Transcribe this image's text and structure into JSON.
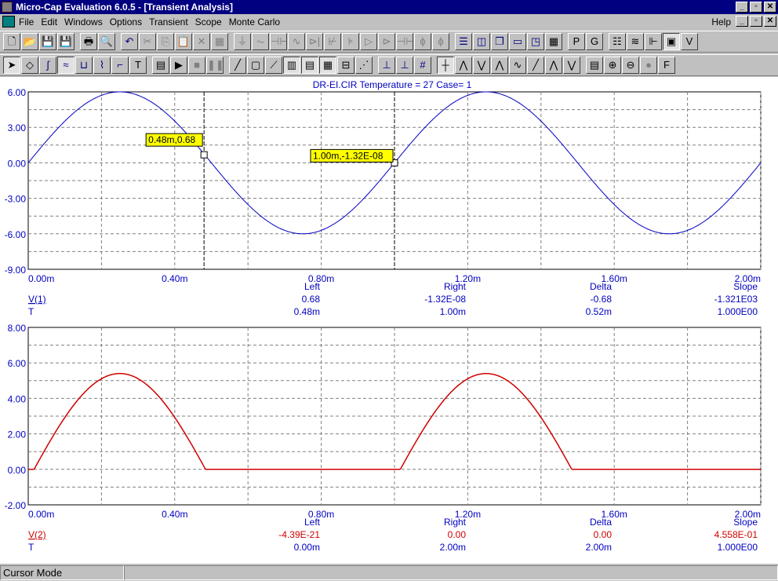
{
  "window": {
    "title": "Micro-Cap Evaluation 6.0.5 - [Transient Analysis]",
    "controls": [
      "_",
      "▫",
      "✕"
    ]
  },
  "menu": {
    "items": [
      "File",
      "Edit",
      "Windows",
      "Options",
      "Transient",
      "Scope",
      "Monte Carlo"
    ],
    "help": "Help"
  },
  "toolbar1": [
    [
      "new-icon",
      "🗋"
    ],
    [
      "open-icon",
      "📂",
      1
    ],
    [
      "save-icon",
      "💾",
      1
    ],
    [
      "save-as-icon",
      "💾",
      1
    ],
    "|",
    [
      "print-icon",
      "🖶"
    ],
    [
      "print-preview-icon",
      "🔍"
    ],
    "|",
    [
      "undo-icon",
      "↶",
      0,
      1
    ],
    [
      "cut-icon",
      "✂",
      1
    ],
    [
      "copy-icon",
      "⎘",
      1
    ],
    [
      "paste-icon",
      "📋",
      1
    ],
    [
      "delete-icon",
      "✕",
      1
    ],
    [
      "select-all-icon",
      "▦",
      1
    ],
    "|",
    [
      "ground-icon",
      "⏚",
      1
    ],
    [
      "resistor-icon",
      "⏦",
      1
    ],
    [
      "capacitor-icon",
      "⊣⊢",
      1
    ],
    [
      "inductor-icon",
      "∿",
      1
    ],
    [
      "diode-icon",
      "⊳|",
      1
    ],
    [
      "transistor-icon",
      "⊬",
      1
    ],
    [
      "mosfet-icon",
      "⊧",
      1
    ],
    [
      "opamp-icon",
      "▷",
      1
    ],
    [
      "buffer-icon",
      "⊳",
      1
    ],
    [
      "battery-icon",
      "⊣⊢",
      1
    ],
    [
      "source-icon",
      "ϕ",
      1
    ],
    [
      "current-source-icon",
      "ϕ",
      1
    ],
    "|",
    [
      "tile-horizontal-icon",
      "☰",
      0,
      1
    ],
    [
      "tile-vertical-icon",
      "◫",
      0,
      1
    ],
    [
      "cascade-icon",
      "❐",
      0,
      1
    ],
    [
      "window-icon",
      "▭",
      0,
      1
    ],
    [
      "window-split-icon",
      "◳",
      0,
      1
    ],
    [
      "calculator-icon",
      "▦"
    ],
    "|",
    [
      "p-icon",
      "P"
    ],
    [
      "g-icon",
      "G"
    ],
    "|",
    [
      "components-icon",
      "☷"
    ],
    [
      "waveform-icon",
      "≋"
    ],
    [
      "probe-icon",
      "⊩"
    ],
    [
      "scope-icon",
      "▣",
      0,
      0,
      1
    ],
    [
      "vi-icon",
      "V"
    ]
  ],
  "toolbar2": [
    [
      "select-arrow-icon",
      "➤",
      0,
      0,
      1
    ],
    [
      "component-mode-icon",
      "◇"
    ],
    [
      "wire-mode-icon",
      "∫",
      0,
      1
    ],
    [
      "graph-mode-icon",
      "≈",
      0,
      1,
      1
    ],
    [
      "label-icon",
      "⊔",
      0,
      1
    ],
    [
      "info-icon",
      "⌇",
      0,
      1
    ],
    [
      "diagonal-wire-icon",
      "⌐",
      0,
      1
    ],
    [
      "text-icon",
      "T"
    ],
    "|",
    [
      "properties-icon",
      "▤"
    ],
    [
      "run-icon",
      "▶"
    ],
    [
      "stop-icon",
      "■",
      1
    ],
    [
      "pause-icon",
      "❚❚",
      1
    ],
    "|",
    [
      "line-icon",
      "╱"
    ],
    [
      "rect-icon",
      "▢"
    ],
    [
      "diagonal-icon",
      "⟋"
    ],
    [
      "grid-vertical-icon",
      "▥",
      0,
      0,
      1
    ],
    [
      "grid-horizontal-icon",
      "▤",
      0,
      0,
      1
    ],
    [
      "grid-dotted-icon",
      "▦",
      0,
      0,
      1
    ],
    [
      "bottom-axis-icon",
      "⊟"
    ],
    [
      "scale-icon",
      "⋰"
    ],
    "|",
    [
      "cursor-left-icon",
      "⊥",
      0,
      1
    ],
    [
      "cursor-right-icon",
      "⊥",
      0,
      1
    ],
    [
      "cursor-both-icon",
      "#",
      0,
      1
    ],
    "|",
    [
      "cursor-mode-icon",
      "┼",
      0,
      0,
      1
    ],
    [
      "peak-icon",
      "⋀"
    ],
    [
      "valley-icon",
      "⋁"
    ],
    [
      "high-icon",
      "⋀"
    ],
    [
      "low-icon",
      "∿"
    ],
    [
      "inflection-icon",
      "╱"
    ],
    [
      "global-high-icon",
      "⋀"
    ],
    [
      "global-low-icon",
      "⋁"
    ],
    "|",
    [
      "table-icon",
      "▤"
    ],
    [
      "zoom-in-icon",
      "⊕"
    ],
    [
      "zoom-out-icon",
      "⊖"
    ],
    [
      "palette-icon",
      "●",
      1
    ],
    [
      "font-icon",
      "F"
    ]
  ],
  "plot_header": "DR-EI.CIR Temperature = 27 Case= 1",
  "colors": {
    "v1": "#0000c0",
    "v2": "#d00000",
    "text_blue": "#0000c0",
    "annotation_bg": "#ffff00"
  },
  "chart_data": [
    {
      "type": "line",
      "series": [
        {
          "name": "V(1)",
          "expr": "6*sin(2*pi*t/1m)"
        }
      ],
      "xlim": [
        0,
        2.0
      ],
      "x_unit": "m",
      "ylim": [
        -9,
        6
      ],
      "x_ticks": [
        "0.00m",
        "0.40m",
        "0.80m",
        "1.20m",
        "1.60m",
        "2.00m"
      ],
      "y_ticks": [
        "6.00",
        "3.00",
        "0.00",
        "-3.00",
        "-6.00",
        "-9.00"
      ],
      "cursors": [
        {
          "x": 0.48,
          "label": "0.48m,0.68",
          "y": 0.68
        },
        {
          "x": 1.0,
          "label": "1.00m,-1.32E-08",
          "y": 0
        }
      ],
      "readout": {
        "headers": [
          "Left",
          "Right",
          "Delta",
          "Slope"
        ],
        "rows": [
          {
            "name": "V(1)",
            "values": [
              "0.68",
              "-1.32E-08",
              "-0.68",
              "-1.321E03"
            ]
          },
          {
            "name": "T",
            "values": [
              "0.48m",
              "1.00m",
              "0.52m",
              "1.000E00"
            ]
          }
        ]
      }
    },
    {
      "type": "line",
      "series": [
        {
          "name": "V(2)",
          "expr": "half-wave rectified, peak 5.4"
        }
      ],
      "xlim": [
        0,
        2.0
      ],
      "x_unit": "m",
      "ylim": [
        -2,
        8
      ],
      "x_ticks": [
        "0.00m",
        "0.40m",
        "0.80m",
        "1.20m",
        "1.60m",
        "2.00m"
      ],
      "y_ticks": [
        "8.00",
        "6.00",
        "4.00",
        "2.00",
        "0.00",
        "-2.00"
      ],
      "readout": {
        "headers": [
          "Left",
          "Right",
          "Delta",
          "Slope"
        ],
        "rows": [
          {
            "name": "V(2)",
            "values": [
              "-4.39E-21",
              "0.00",
              "0.00",
              "4.558E-01"
            ]
          },
          {
            "name": "T",
            "values": [
              "0.00m",
              "2.00m",
              "2.00m",
              "1.000E00"
            ]
          }
        ]
      }
    }
  ],
  "status": {
    "mode": "Cursor Mode"
  }
}
